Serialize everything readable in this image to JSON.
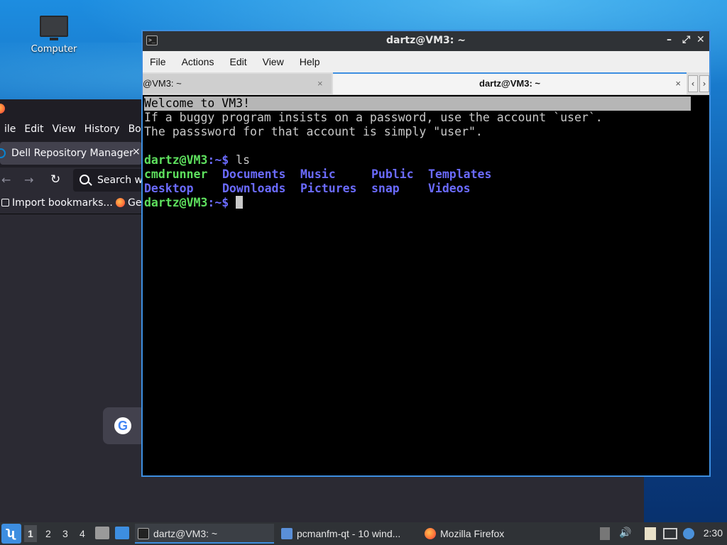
{
  "desktop": {
    "icon_label": "Computer"
  },
  "firefox": {
    "menu": [
      "ile",
      "Edit",
      "View",
      "History",
      "Boo"
    ],
    "tab_label": "Dell Repository Manager",
    "tab_close": "×",
    "search_placeholder": "Search w",
    "bookmarks": {
      "import": "Import bookmarks...",
      "partial": "Ge"
    },
    "shortcut_letter": "G"
  },
  "terminal": {
    "title": "dartz@VM3: ~",
    "window_buttons": {
      "minimize": "–",
      "maximize": "⤢",
      "close": "✕"
    },
    "menu": [
      "File",
      "Actions",
      "Edit",
      "View",
      "Help"
    ],
    "tabs": [
      {
        "label": "@VM3: ~",
        "close": "×"
      },
      {
        "label": "dartz@VM3: ~",
        "close": "×"
      }
    ],
    "scroll_left": "‹",
    "scroll_right": "›",
    "lines": {
      "welcome": "Welcome to VM3!",
      "l2": "If a buggy program insists on a password, use the account `user`.",
      "l3": "The passsword for that account is simply \"user\".",
      "prompt_user": "dartz@VM3",
      "prompt_path": ":~$ ",
      "cmd": "ls",
      "ls_row1": [
        "cmdrunner",
        "Documents",
        "Music",
        "Public",
        "Templates"
      ],
      "ls_row2": [
        "Desktop",
        "Downloads",
        "Pictures",
        "snap",
        "Videos"
      ]
    }
  },
  "taskbar": {
    "start_glyph": "ʯ",
    "workspaces": [
      "1",
      "2",
      "3",
      "4"
    ],
    "tasks": [
      {
        "label": "dartz@VM3: ~"
      },
      {
        "label": "pcmanfm-qt - 10 wind..."
      },
      {
        "label": "Mozilla Firefox"
      }
    ],
    "volume_glyph": "🔊",
    "clock": "2:30",
    "colors": {
      "accent": "#3d8ee0",
      "panel": "#2f3236"
    }
  }
}
